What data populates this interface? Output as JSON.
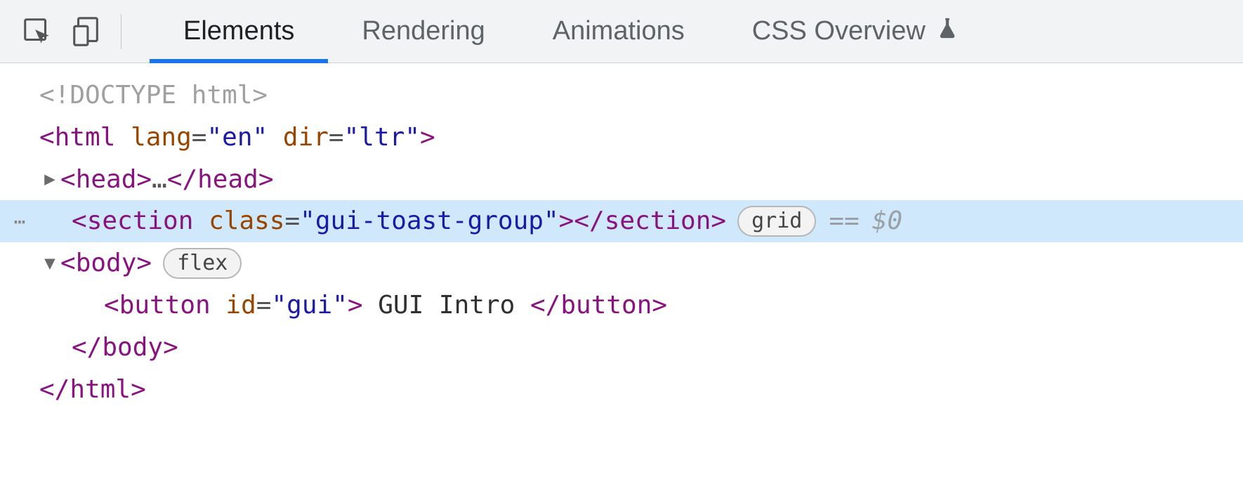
{
  "toolbar": {
    "tabs": [
      {
        "label": "Elements",
        "active": true
      },
      {
        "label": "Rendering",
        "active": false
      },
      {
        "label": "Animations",
        "active": false
      },
      {
        "label": "CSS Overview",
        "active": false,
        "flask": true
      }
    ]
  },
  "dom": {
    "doctype": "<!DOCTYPE html>",
    "html_open": {
      "tag": "html",
      "attrs": [
        {
          "name": "lang",
          "value": "en"
        },
        {
          "name": "dir",
          "value": "ltr"
        }
      ]
    },
    "head": {
      "tag": "head",
      "collapsed": true,
      "ellipsis": "…"
    },
    "section": {
      "tag": "section",
      "attrs": [
        {
          "name": "class",
          "value": "gui-toast-group"
        }
      ],
      "badge": "grid",
      "selected_suffix_eq": "==",
      "selected_suffix_ref": "$0"
    },
    "body_open": {
      "tag": "body",
      "badge": "flex"
    },
    "button": {
      "tag": "button",
      "attrs": [
        {
          "name": "id",
          "value": "gui"
        }
      ],
      "text": " GUI Intro "
    },
    "body_close": {
      "tag": "body"
    },
    "html_close": {
      "tag": "html"
    }
  }
}
